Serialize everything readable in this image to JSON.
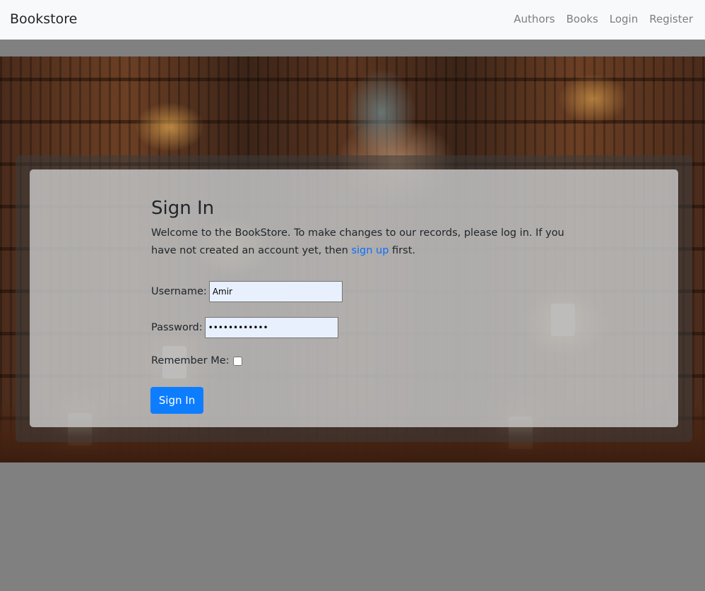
{
  "navbar": {
    "brand": "Bookstore",
    "links": [
      "Authors",
      "Books",
      "Login",
      "Register"
    ]
  },
  "signin": {
    "title": "Sign In",
    "intro_before": "Welcome to the BookStore. To make changes to our records, please log in. If you have not created an account yet, then ",
    "signup_link": "sign up",
    "intro_after": " first.",
    "username_label": "Username:",
    "username_value": "Amir",
    "password_label": "Password:",
    "password_value": "••••••••••••",
    "remember_label": "Remember Me:",
    "remember_checked": false,
    "submit_label": "Sign In"
  },
  "colors": {
    "accent": "#0d7dff",
    "link": "#0d6efd",
    "navbar_bg": "#f8f9fa",
    "page_bg": "#808080"
  }
}
